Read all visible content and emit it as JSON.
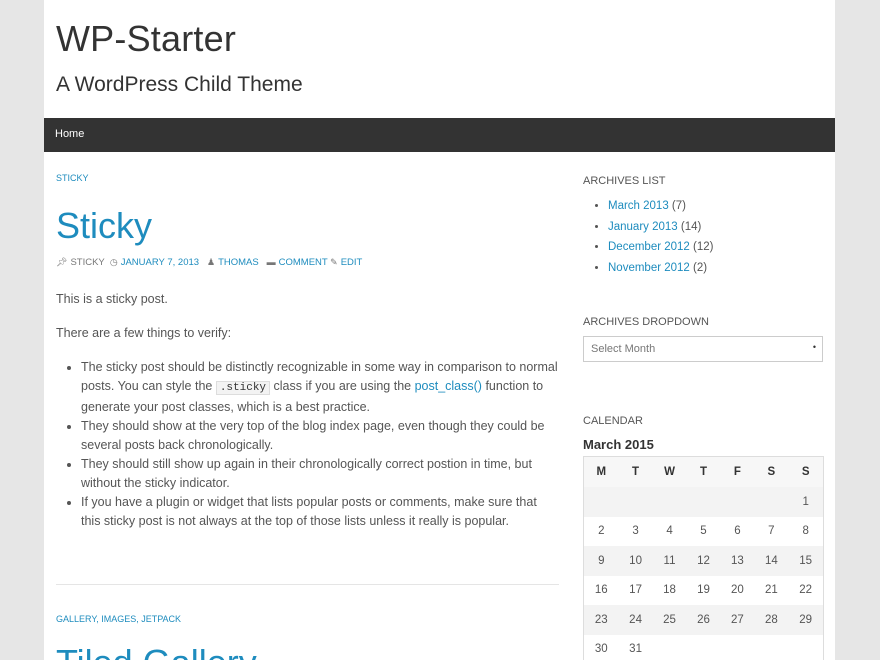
{
  "site": {
    "title": "WP-Starter",
    "description": "A WordPress Child Theme"
  },
  "nav": {
    "home": "Home"
  },
  "post1": {
    "categories": "STICKY",
    "title": "Sticky",
    "meta": {
      "format": "STICKY",
      "date": "JANUARY 7, 2013",
      "author": "THOMAS",
      "comment": "COMMENT",
      "edit": "EDIT"
    },
    "p1": "This is a sticky post.",
    "p2": "There are a few things to verify:",
    "bullets": {
      "b1_a": "The sticky post should be distinctly recognizable in some way in comparison to normal posts. You can style the ",
      "b1_code": ".sticky",
      "b1_b": " class if you are using the ",
      "b1_link": "post_class()",
      "b1_c": " function to generate your post classes, which is a best practice.",
      "b2": "They should show at the very top of the blog index page, even though they could be several posts back chronologically.",
      "b3": "They should still show up again in their chronologically correct postion in time, but without the sticky indicator.",
      "b4": "If you have a plugin or widget that lists popular posts or comments, make sure that this sticky post is not always at the top of those lists unless it really is popular."
    }
  },
  "post2": {
    "categories": "GALLERY, IMAGES, JETPACK",
    "title_partial": "Tiled Gallery"
  },
  "sidebar": {
    "archives_list": {
      "title": "ARCHIVES LIST",
      "items": [
        {
          "label": "March 2013",
          "count": " (7)"
        },
        {
          "label": "January 2013",
          "count": " (14)"
        },
        {
          "label": "December 2012",
          "count": " (12)"
        },
        {
          "label": "November 2012",
          "count": " (2)"
        }
      ]
    },
    "archives_dropdown": {
      "title": "ARCHIVES DROPDOWN",
      "selected": "Select Month"
    },
    "calendar": {
      "title": "CALENDAR",
      "caption": "March 2015",
      "days": [
        "M",
        "T",
        "W",
        "T",
        "F",
        "S",
        "S"
      ],
      "weeks": [
        [
          "",
          "",
          "",
          "",
          "",
          "",
          "1"
        ],
        [
          "2",
          "3",
          "4",
          "5",
          "6",
          "7",
          "8"
        ],
        [
          "9",
          "10",
          "11",
          "12",
          "13",
          "14",
          "15"
        ],
        [
          "16",
          "17",
          "18",
          "19",
          "20",
          "21",
          "22"
        ],
        [
          "23",
          "24",
          "25",
          "26",
          "27",
          "28",
          "29"
        ],
        [
          "30",
          "31",
          "",
          "",
          "",
          "",
          ""
        ]
      ]
    }
  }
}
